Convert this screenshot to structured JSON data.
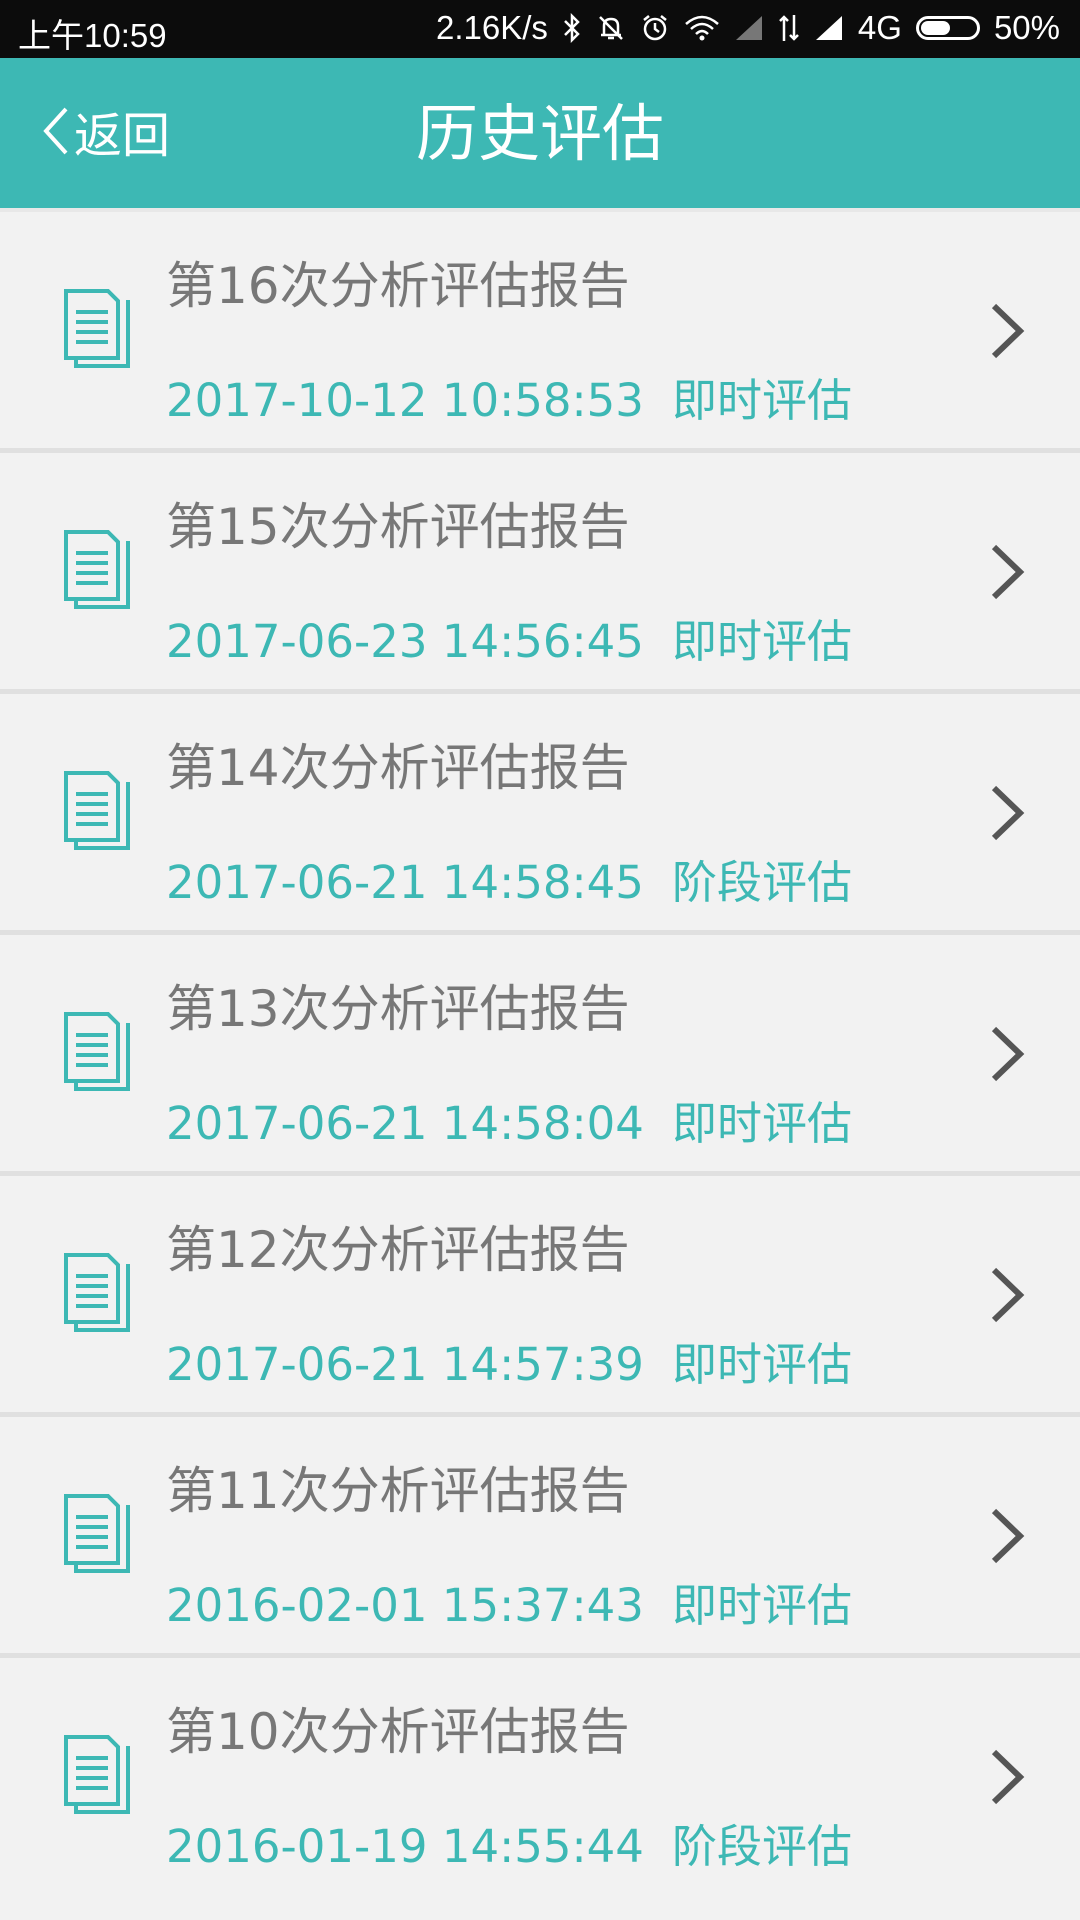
{
  "status_bar": {
    "time": "上午10:59",
    "net_speed": "2.16K/s",
    "network": "4G",
    "battery": "50%",
    "icons": [
      "bluetooth-icon",
      "mute-icon",
      "alarm-icon",
      "wifi-icon",
      "signal-icon",
      "data-icon",
      "signal-icon",
      "battery-icon"
    ]
  },
  "header": {
    "back_label": "返回",
    "title": "历史评估"
  },
  "colors": {
    "accent": "#3db8b4",
    "title_text": "#777777",
    "background": "#f2f2f2"
  },
  "reports": [
    {
      "title": "第16次分析评估报告",
      "datetime": "2017-10-12 10:58:53",
      "type": "即时评估"
    },
    {
      "title": "第15次分析评估报告",
      "datetime": "2017-06-23 14:56:45",
      "type": "即时评估"
    },
    {
      "title": "第14次分析评估报告",
      "datetime": "2017-06-21 14:58:45",
      "type": "阶段评估"
    },
    {
      "title": "第13次分析评估报告",
      "datetime": "2017-06-21 14:58:04",
      "type": "即时评估"
    },
    {
      "title": "第12次分析评估报告",
      "datetime": "2017-06-21 14:57:39",
      "type": "即时评估"
    },
    {
      "title": "第11次分析评估报告",
      "datetime": "2016-02-01 15:37:43",
      "type": "即时评估"
    },
    {
      "title": "第10次分析评估报告",
      "datetime": "2016-01-19 14:55:44",
      "type": "阶段评估"
    }
  ]
}
